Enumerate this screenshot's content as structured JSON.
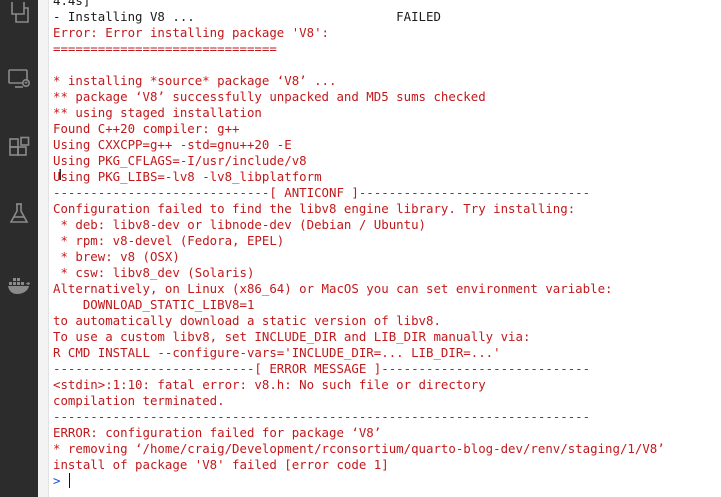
{
  "activity_bar": {
    "icons": [
      "explorer-icon",
      "remote-explorer-icon",
      "extensions-icon",
      "testing-icon",
      "docker-icon"
    ]
  },
  "console": {
    "lines": [
      {
        "text": "4.4s]",
        "style": "plain"
      },
      {
        "text": "- Installing V8 ...                           FAILED",
        "style": "plain"
      },
      {
        "text": "Error: Error installing package 'V8':",
        "style": "err"
      },
      {
        "text": "==============================",
        "style": "err"
      },
      {
        "text": "",
        "style": "err"
      },
      {
        "text": "* installing *source* package ‘V8’ ...",
        "style": "err"
      },
      {
        "text": "** package ‘V8’ successfully unpacked and MD5 sums checked",
        "style": "err"
      },
      {
        "text": "** using staged installation",
        "style": "err"
      },
      {
        "text": "Found C++20 compiler: g++",
        "style": "err"
      },
      {
        "text": "Using CXXCPP=g++ -std=gnu++20 -E",
        "style": "err"
      },
      {
        "text": "Using PKG_CFLAGS=-I/usr/include/v8",
        "style": "err"
      },
      {
        "text": "Using PKG_LIBS=-lv8 -lv8_libplatform",
        "style": "err"
      },
      {
        "text": "-----------------------------[ ANTICONF ]-------------------------------",
        "style": "err"
      },
      {
        "text": "Configuration failed to find the libv8 engine library. Try installing:",
        "style": "err"
      },
      {
        "text": " * deb: libv8-dev or libnode-dev (Debian / Ubuntu)",
        "style": "err"
      },
      {
        "text": " * rpm: v8-devel (Fedora, EPEL)",
        "style": "err"
      },
      {
        "text": " * brew: v8 (OSX)",
        "style": "err"
      },
      {
        "text": " * csw: libv8_dev (Solaris)",
        "style": "err"
      },
      {
        "text": "Alternatively, on Linux (x86_64) or MacOS you can set environment variable:",
        "style": "err"
      },
      {
        "text": "    DOWNLOAD_STATIC_LIBV8=1",
        "style": "err"
      },
      {
        "text": "to automatically download a static version of libv8.",
        "style": "err"
      },
      {
        "text": "To use a custom libv8, set INCLUDE_DIR and LIB_DIR manually via:",
        "style": "err"
      },
      {
        "text": "R CMD INSTALL --configure-vars='INCLUDE_DIR=... LIB_DIR=...'",
        "style": "err"
      },
      {
        "text": "---------------------------[ ERROR MESSAGE ]----------------------------",
        "style": "err"
      },
      {
        "text": "<stdin>:1:10: fatal error: v8.h: No such file or directory",
        "style": "err"
      },
      {
        "text": "compilation terminated.",
        "style": "err"
      },
      {
        "text": "------------------------------------------------------------------------",
        "style": "err"
      },
      {
        "text": "ERROR: configuration failed for package ‘V8’",
        "style": "err"
      },
      {
        "text": "* removing ‘/home/craig/Development/rconsortium/quarto-blog-dev/renv/staging/1/V8’",
        "style": "err"
      },
      {
        "text": "install of package 'V8' failed [error code 1]",
        "style": "err"
      }
    ],
    "prompt_symbol": ">",
    "input_value": ""
  },
  "colors": {
    "error_text": "#c2191c",
    "plain_text": "#1b1b1b",
    "prompt": "#1a4fd6",
    "activity_bar_bg": "#2c2c2c"
  }
}
